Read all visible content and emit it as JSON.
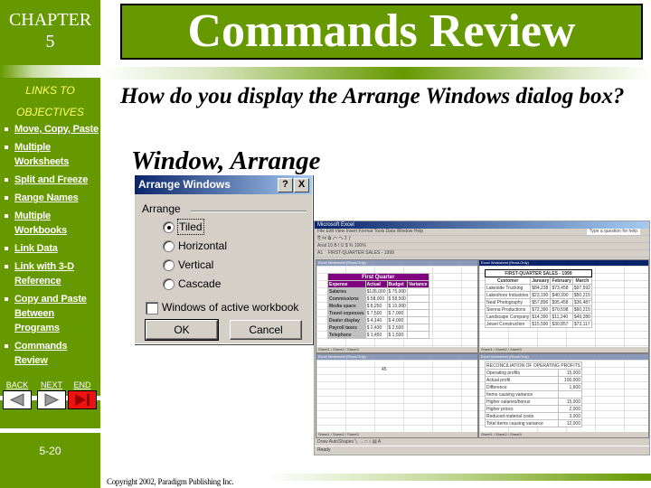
{
  "sidebar": {
    "chapter_label": "CHAPTER",
    "chapter_number": "5",
    "links_heading_line1": "LINKS TO",
    "links_heading_line2": "OBJECTIVES",
    "links": [
      {
        "label": "Move, Copy, Paste"
      },
      {
        "label": "Multiple Worksheets"
      },
      {
        "label": "Split and Freeze"
      },
      {
        "label": "Range Names"
      },
      {
        "label": "Multiple Workbooks"
      },
      {
        "label": "Link Data"
      },
      {
        "label": "Link with 3-D Reference"
      },
      {
        "label": "Copy and Paste Between Programs"
      },
      {
        "label": "Commands Review"
      }
    ],
    "nav": {
      "back_label": "BACK",
      "next_label": "NEXT",
      "end_label": "END"
    },
    "page_number": "5-20"
  },
  "header": {
    "title": "Commands Review"
  },
  "content": {
    "question": "How do you display the Arrange Windows dialog box?",
    "answer": "Window, Arrange"
  },
  "dialog": {
    "title": "Arrange Windows",
    "help_button": "?",
    "close_button": "X",
    "group_label": "Arrange",
    "options": [
      {
        "label": "Tiled",
        "selected": true
      },
      {
        "label": "Horizontal",
        "selected": false
      },
      {
        "label": "Vertical",
        "selected": false
      },
      {
        "label": "Cascade",
        "selected": false
      }
    ],
    "checkbox_label": "Windows of active workbook",
    "checkbox_checked": false,
    "ok_label": "OK",
    "cancel_label": "Cancel"
  },
  "excel": {
    "app_title": "Microsoft Excel",
    "menu": "File  Edit  View  Insert  Format  Tools  Data  Window  Help",
    "toolbar": "Arial   10   B  I  U   $  %   100%",
    "name_box": "A1",
    "formula": "FIRST-QUARTER SALES - 1999",
    "help_box": "Type a question for help",
    "pane1": {
      "title": "Excel Worksheet (Read-Only)",
      "heading": "First Quarter",
      "columns": [
        "Expense",
        "Actual",
        "Budget",
        "Variance"
      ],
      "rows": [
        [
          "Salaries",
          "$126,000",
          "$ 75,000"
        ],
        [
          "Commissions",
          "$ 58,000",
          "$ 58,500"
        ],
        [
          "Media space",
          "$ 8,250",
          "$ 10,000"
        ],
        [
          "Travel expenses",
          "$ 7,500",
          "$ 7,000"
        ],
        [
          "Dealer display",
          "$ 4,140",
          "$ 4,000"
        ],
        [
          "Payroll taxes",
          "$ 2,430",
          "$ 2,500"
        ],
        [
          "Telephone",
          "$ 1,450",
          "$ 1,500"
        ]
      ],
      "tabs": "Sheet1 / Sheet2 / Sheet3"
    },
    "pane2": {
      "title": "Excel Worksheet (Read-Only)",
      "heading": "FIRST-QUARTER SALES - 1999",
      "columns": [
        "Customer",
        "January",
        "February",
        "March"
      ],
      "rows": [
        [
          "Lakeside Trucking",
          "$84,238",
          "$73,458",
          "$97,592"
        ],
        [
          "Lakeshore Industries",
          "$23,190",
          "$40,390",
          "$50,215"
        ],
        [
          "Neal Photography",
          "$57,896",
          "$95,458",
          "$36,487"
        ],
        [
          "Sienna Productions",
          "$72,390",
          "$70,598",
          "$60,215"
        ],
        [
          "Landscape Company",
          "$14,390",
          "$11,240",
          "$49,280"
        ],
        [
          "Jewel Construction",
          "$15,590",
          "$30,857",
          "$73,117"
        ]
      ],
      "tabs": "Sheet1 / Sheet2 / Sheet3"
    },
    "pane3": {
      "title": "Excel Worksheet (Read-Only)",
      "cell_c1": "45",
      "tabs": "Sheet1 / Sheet2 / Sheet3"
    },
    "pane4": {
      "title": "Excel Worksheet (Read-Only)",
      "heading": "RECONCILIATION OF OPERATING PROFITS",
      "rows": [
        [
          "Operating profits",
          "15,000"
        ],
        [
          "Actual profit",
          "100,000"
        ],
        [
          "Difference",
          "1,600"
        ],
        [
          "",
          ""
        ],
        [
          "Items causing variance",
          ""
        ],
        [
          "Higher salaries/bonus",
          "15,000"
        ],
        [
          "Higher prices",
          "2,000"
        ],
        [
          "Reduced material costs",
          "3,000"
        ],
        [
          "",
          ""
        ],
        [
          "Total items causing variance",
          "12,000"
        ]
      ],
      "tabs": "Sheet1 / Sheet2 / Sheet3"
    },
    "draw_toolbar": "Draw   AutoShapes",
    "status": "Ready"
  },
  "footer": {
    "copyright": "Copyright 2002, Paradigm Publishing Inc."
  },
  "colors": {
    "accent": "#669900",
    "links_heading": "#ffff66",
    "end_button": "#ee1111",
    "dialog_bg": "#d4d0c8",
    "dialog_title": "#0a246a"
  }
}
